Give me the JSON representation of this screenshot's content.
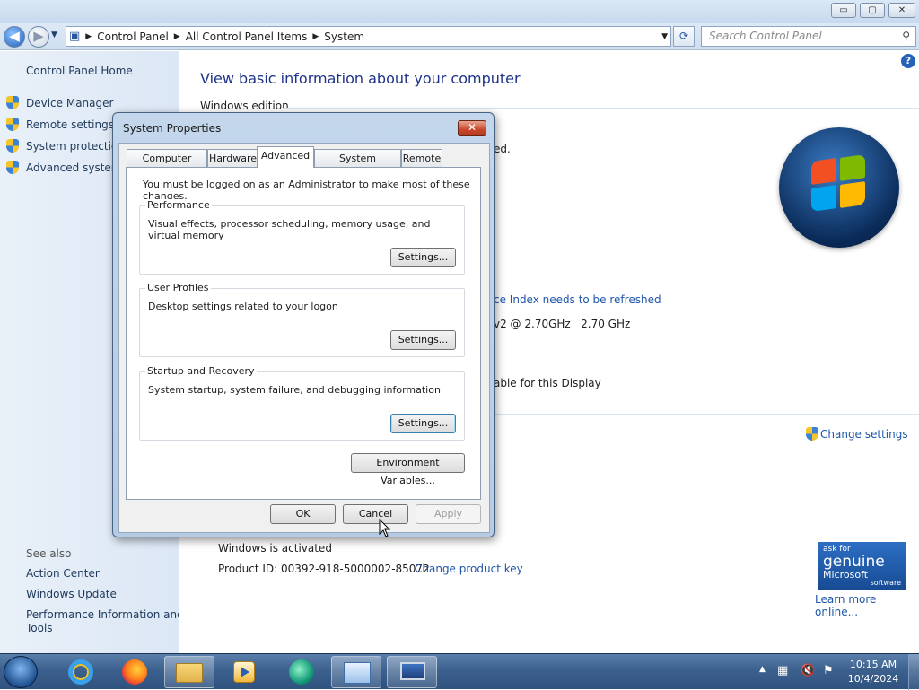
{
  "window": {
    "breadcrumb": [
      "Control Panel",
      "All Control Panel Items",
      "System"
    ],
    "search_placeholder": "Search Control Panel",
    "caption_buttons": {
      "minimize": "▭",
      "maximize": "▢",
      "close": "✕"
    }
  },
  "left_pane": {
    "home": "Control Panel Home",
    "tasks": [
      "Device Manager",
      "Remote settings",
      "System protection",
      "Advanced system"
    ],
    "see_also_header": "See also",
    "see_also": [
      "Action Center",
      "Windows Update",
      "Performance Information and",
      "Tools"
    ]
  },
  "main": {
    "heading": "View basic information about your computer",
    "windows_edition": "Windows edition",
    "partial_reserved": "ed.",
    "partial_index": "ce Index needs to be refreshed",
    "partial_processor": "v2 @ 2.70GHz   2.70 GHz",
    "partial_pen": "able for this Display",
    "change_settings": "Change settings",
    "activation": "Windows is activated",
    "product_id": "Product ID: 00392-918-5000002-85072",
    "change_key": "Change product key",
    "learn_more": "Learn more online...",
    "genuine": {
      "line1": "ask for",
      "line2": "genuine",
      "line3": "Microsoft",
      "line4": "software"
    }
  },
  "dialog": {
    "title": "System Properties",
    "tabs": [
      "Computer Name",
      "Hardware",
      "Advanced",
      "System Protection",
      "Remote"
    ],
    "selected_tab": "Advanced",
    "admin_note": "You must be logged on as an Administrator to make most of these changes.",
    "groups": [
      {
        "label": "Performance",
        "desc": "Visual effects, processor scheduling, memory usage, and virtual memory",
        "button": "Settings..."
      },
      {
        "label": "User Profiles",
        "desc": "Desktop settings related to your logon",
        "button": "Settings..."
      },
      {
        "label": "Startup and Recovery",
        "desc": "System startup, system failure, and debugging information",
        "button": "Settings..."
      }
    ],
    "env_button": "Environment Variables...",
    "ok": "OK",
    "cancel": "Cancel",
    "apply": "Apply"
  },
  "taskbar": {
    "icons": [
      "start-orb",
      "internet-explorer",
      "firefox",
      "windows-explorer",
      "media-player",
      "app-icon",
      "control-panel",
      "system-properties"
    ],
    "time": "10:15 AM",
    "date": "10/4/2024"
  }
}
